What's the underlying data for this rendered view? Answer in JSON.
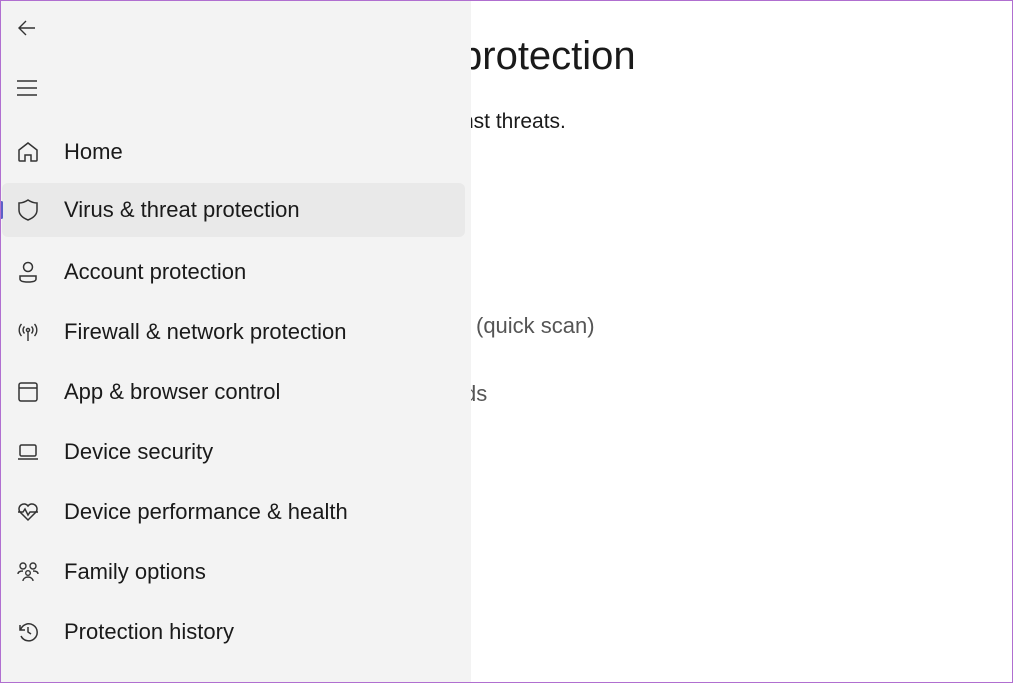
{
  "main": {
    "title_fragment": "protection",
    "subtitle_fragment": "nst threats.",
    "line1_fragment": "(quick scan)",
    "line2_fragment": "ds"
  },
  "sidebar": {
    "back_icon": "arrow-left-icon",
    "menu_icon": "hamburger-icon",
    "accent": "#5b5fc7",
    "items": [
      {
        "label": "Home",
        "icon": "home-icon"
      },
      {
        "label": "Virus & threat protection",
        "icon": "shield-icon",
        "active": true
      },
      {
        "label": "Account protection",
        "icon": "person-icon"
      },
      {
        "label": "Firewall & network protection",
        "icon": "antenna-icon"
      },
      {
        "label": "App & browser control",
        "icon": "window-icon"
      },
      {
        "label": "Device security",
        "icon": "laptop-icon"
      },
      {
        "label": "Device performance & health",
        "icon": "heart-pulse-icon"
      },
      {
        "label": "Family options",
        "icon": "family-icon"
      },
      {
        "label": "Protection history",
        "icon": "history-icon"
      }
    ]
  }
}
